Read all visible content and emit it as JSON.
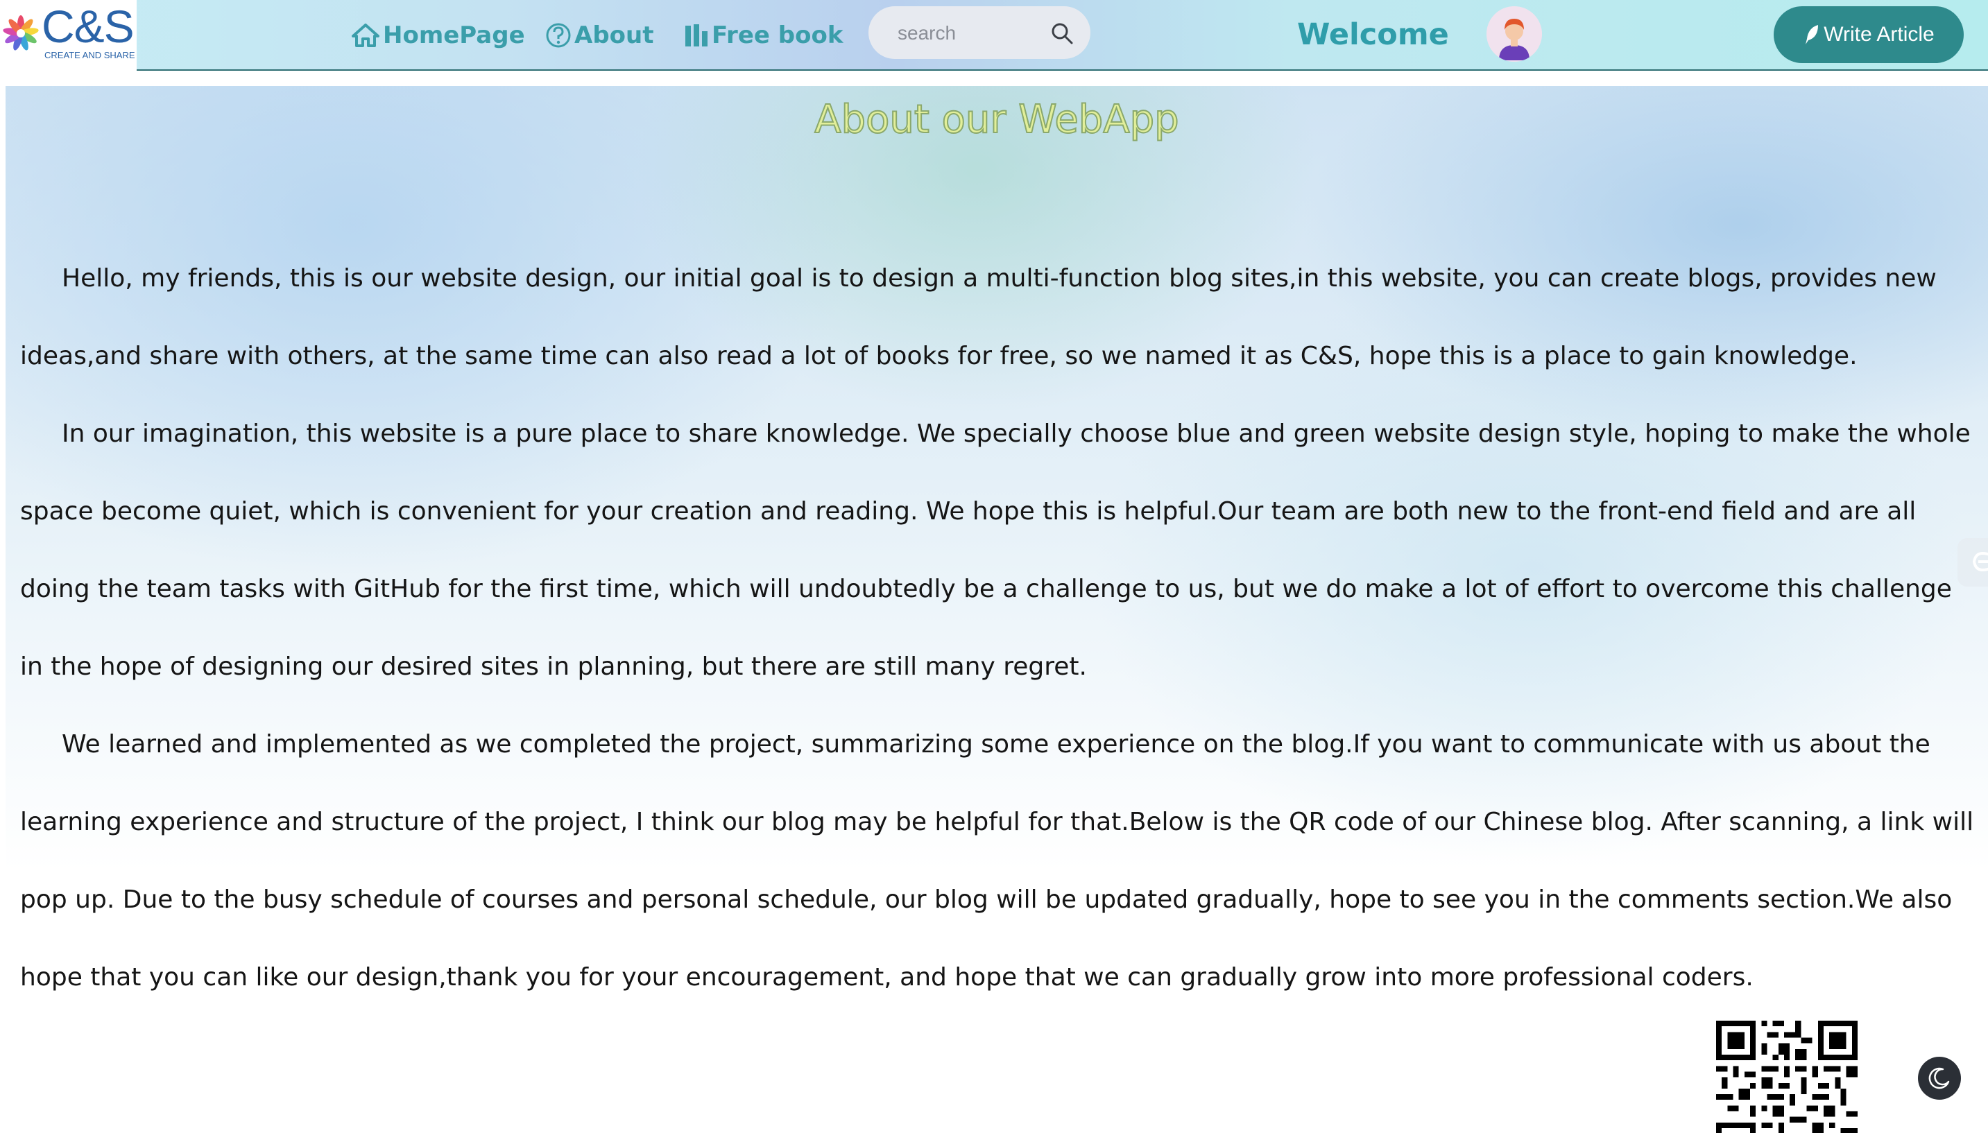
{
  "brand": {
    "name": "C&S",
    "tagline": "CREATE AND SHARE"
  },
  "nav": {
    "home": "HomePage",
    "about": "About",
    "freebook": "Free book"
  },
  "search": {
    "placeholder": "search"
  },
  "header": {
    "welcome": "Welcome",
    "write_label": "Write Article"
  },
  "page": {
    "title": "About our WebApp",
    "paragraphs": [
      "Hello, my friends, this is our website design, our initial goal is to design a multi-function blog sites,in this website, you can create blogs, provides new ideas,and share with others, at the same time can also read a lot of books for free, so we named it as C&S, hope this is a place to gain knowledge.",
      "In our imagination, this website is a pure place to share knowledge. We specially choose blue and green website design style, hoping to make the whole space become quiet, which is convenient for your creation and reading. We hope this is helpful.Our team are both new to the front-end field and are all doing the team tasks with GitHub for the first time, which will undoubtedly be a challenge to us, but we do make a lot of effort to overcome this challenge in the hope of designing our desired sites in planning, but there are still many regret.",
      "We learned and implemented as we completed the project, summarizing some experience on the blog.If you want to communicate with us about the learning experience and structure of the project, I think our blog may be helpful for that.Below is the QR code of our Chinese blog. After scanning, a link will pop up. Due to the busy schedule of courses and personal schedule, our blog will be updated gradually, hope to see you in the comments section.We also hope that you can like our design,thank you for your encouragement, and hope that we can gradually grow into more professional coders."
    ]
  },
  "colors": {
    "nav_link": "#3a9eaa",
    "write_button": "#2e8a8c",
    "title_fill": "#e2ef9a",
    "body_text": "#151515"
  },
  "icons": {
    "home": "home-icon",
    "about": "question-circle-icon",
    "freebook": "bar-chart-icon",
    "search": "search-icon",
    "write": "feather-pen-icon",
    "dark_mode": "moon-icon",
    "side_widget": "menu-widget-icon"
  }
}
